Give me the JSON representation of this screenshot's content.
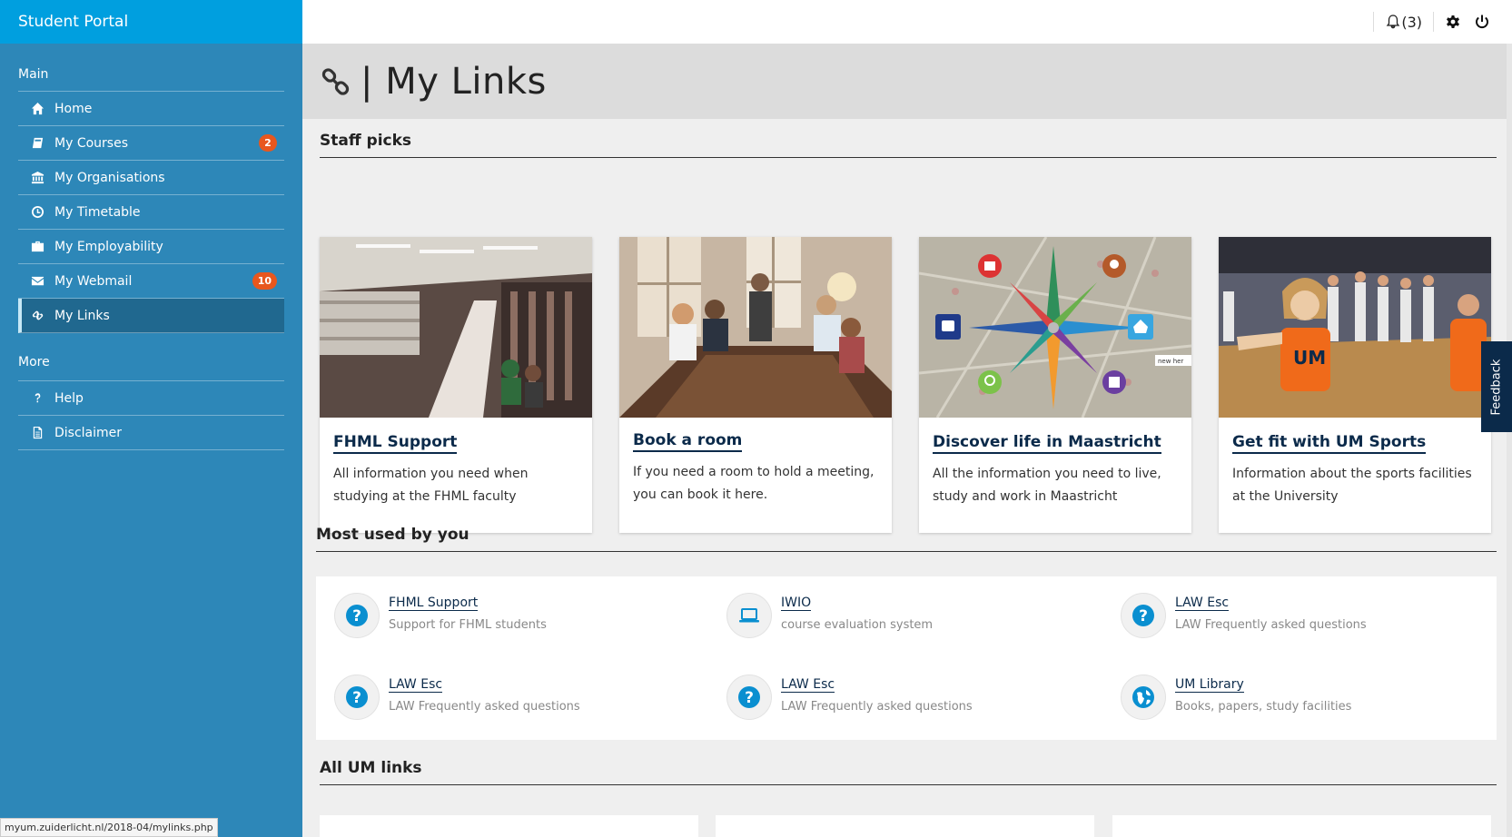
{
  "brand": "Student Portal",
  "sidebar": {
    "main_label": "Main",
    "more_label": "More",
    "main_items": [
      {
        "label": "Home",
        "icon": "home-icon"
      },
      {
        "label": "My Courses",
        "icon": "book-icon",
        "badge": "2"
      },
      {
        "label": "My Organisations",
        "icon": "institution-icon"
      },
      {
        "label": "My Timetable",
        "icon": "clock-icon"
      },
      {
        "label": "My Employability",
        "icon": "briefcase-icon"
      },
      {
        "label": "My Webmail",
        "icon": "envelope-icon",
        "badge": "10"
      },
      {
        "label": "My Links",
        "icon": "link-icon",
        "active": true
      }
    ],
    "more_items": [
      {
        "label": "Help",
        "icon": "question-icon"
      },
      {
        "label": "Disclaimer",
        "icon": "document-icon"
      }
    ]
  },
  "topbar": {
    "notifications": "(3)"
  },
  "page": {
    "title": "| My Links"
  },
  "staff_picks": {
    "heading": "Staff picks",
    "cards": [
      {
        "title": "FHML Support",
        "desc": "All information you need when studying at the FHML faculty"
      },
      {
        "title": "Book a room",
        "desc": "If you need a room to hold a meeting, you can book it here."
      },
      {
        "title": "Discover life in Maastricht",
        "desc": "All the information you need to live, study and work in Maastricht"
      },
      {
        "title": "Get fit with UM Sports",
        "desc": "Information about the sports facilities at the University"
      }
    ]
  },
  "most_used": {
    "heading": "Most used by you",
    "items": [
      {
        "title": "FHML Support",
        "desc": "Support for FHML students",
        "icon": "question-icon"
      },
      {
        "title": "IWIO",
        "desc": "course evaluation system",
        "icon": "laptop-icon"
      },
      {
        "title": "LAW Esc",
        "desc": "LAW Frequently asked questions",
        "icon": "question-icon"
      },
      {
        "title": "LAW Esc",
        "desc": "LAW Frequently asked questions",
        "icon": "question-icon"
      },
      {
        "title": "LAW Esc",
        "desc": "LAW Frequently asked questions",
        "icon": "question-icon"
      },
      {
        "title": "UM Library",
        "desc": "Books, papers, study facilities",
        "icon": "globe-icon"
      }
    ]
  },
  "all_links": {
    "heading": "All UM links"
  },
  "feedback_label": "Feedback",
  "status_url": "myum.zuiderlicht.nl/2018-04/mylinks.php",
  "colors": {
    "sidebar": "#2d87b8",
    "brand": "#009fdf",
    "accent": "#0b2a4a",
    "badge": "#e8571e"
  }
}
